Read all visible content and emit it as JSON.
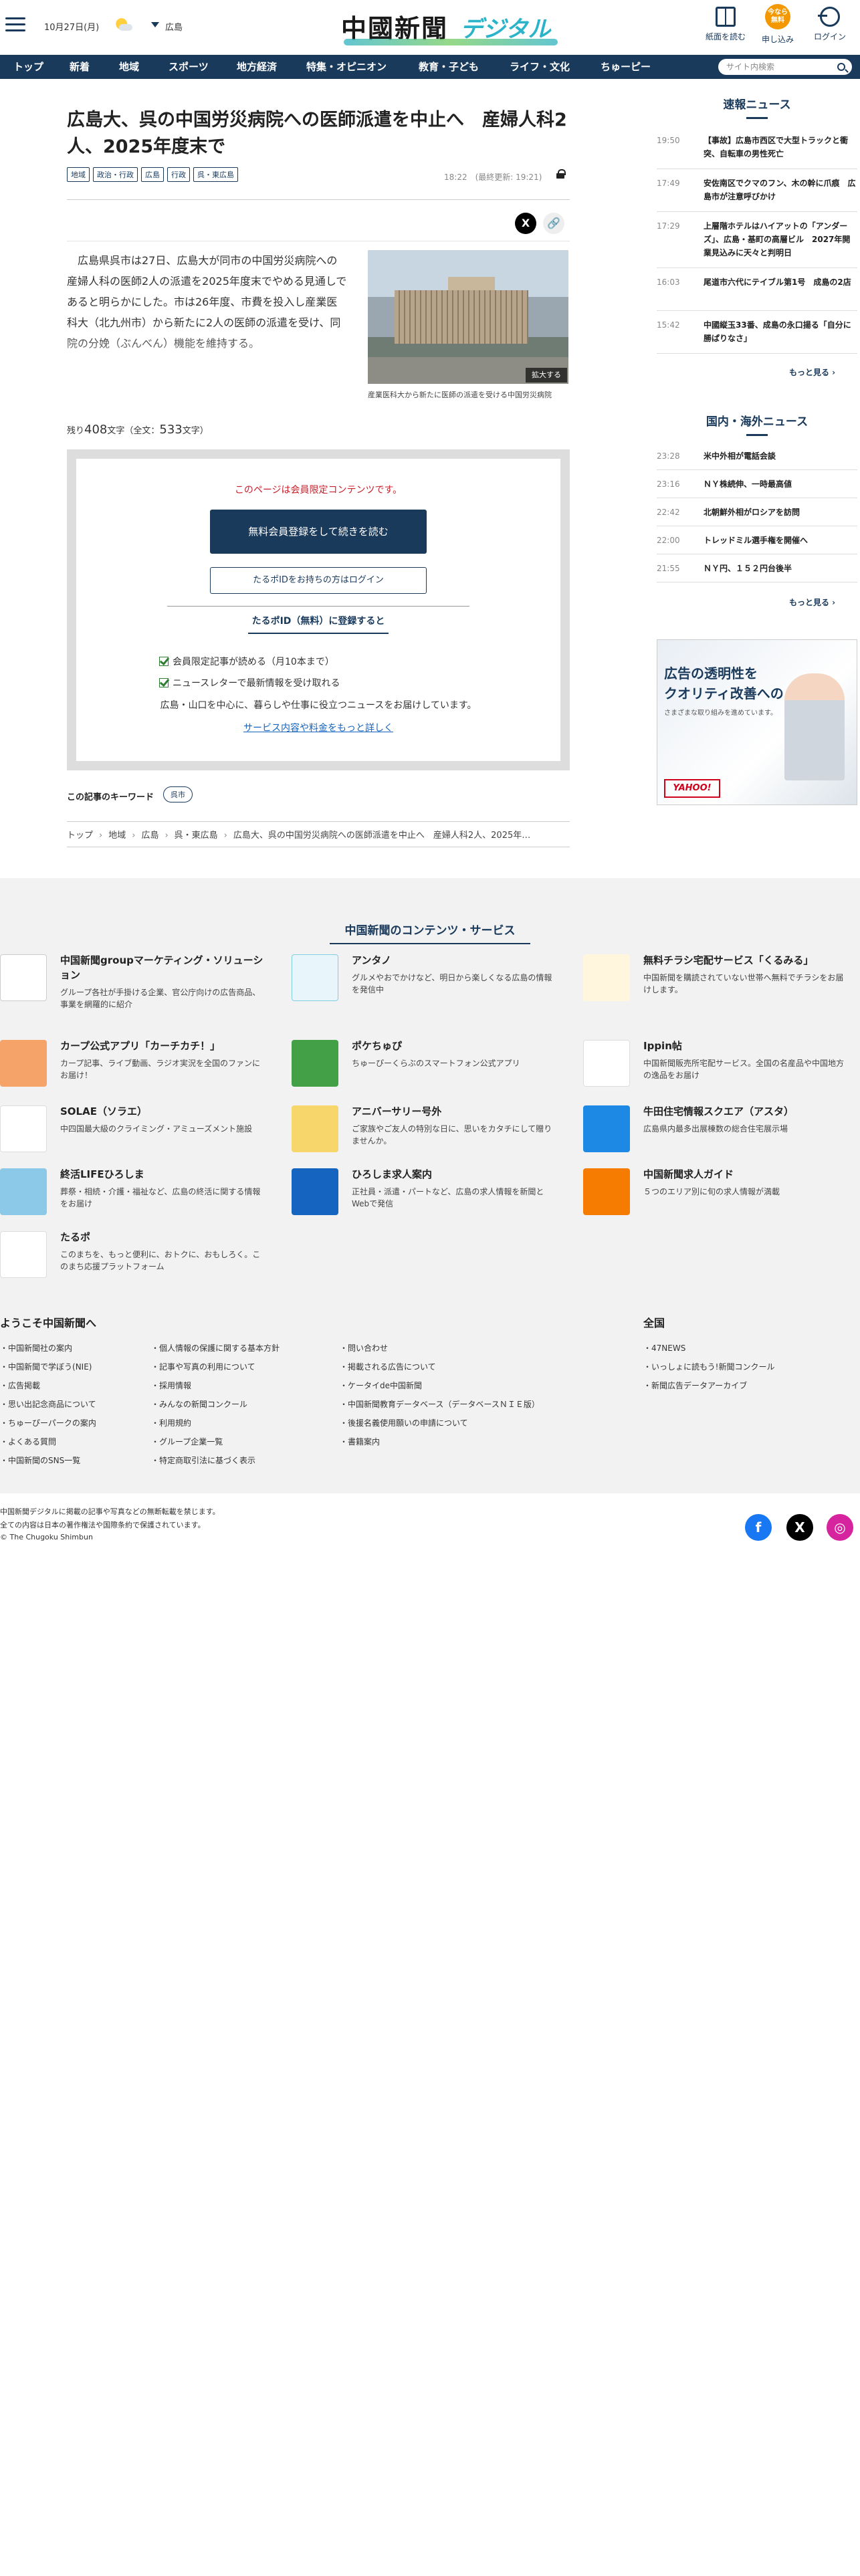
{
  "header": {
    "date": "10月27日(月)",
    "weather_icon": "sun-cloud-icon",
    "region": "広島",
    "logo_main": "中國新聞",
    "logo_sub": "デジタル",
    "buttons": [
      {
        "label": "紙面を読む",
        "icon": "newspaper-icon"
      },
      {
        "label": "申し込み",
        "icon_text": "今なら 無料",
        "icon": "apply-badge-icon"
      },
      {
        "label": "ログイン",
        "icon": "login-icon"
      }
    ]
  },
  "nav": {
    "items": [
      "トップ",
      "新着",
      "地域",
      "スポーツ",
      "地方経済",
      "特集・オピニオン",
      "教育・子ども",
      "ライフ・文化",
      "ちゅーピー"
    ],
    "search_placeholder": "サイト内検索"
  },
  "article": {
    "title": "広島大、呉の中国労災病院への医師派遣を中止へ　産婦人科2人、2025年度末で",
    "tags": [
      "地域",
      "政治・行政",
      "広島",
      "行政",
      "呉・東広島"
    ],
    "timestamp": "18:22　(最終更新: 19:21)",
    "lead": "広島県呉市は27日、広島大が同市の中国労災病院への産婦人科の医師2人の派遣を2025年度末でやめる見通しであると明らかにした。市は26年度、市費を投入し産業医科大（北九州市）から新たに2人の医師の派遣を受け、同院の分娩（ぶんべん）機能を維持する。",
    "photo_enlarge": "拡大する",
    "photo_caption": "産業医科大から新たに医師の派遣を受ける中国労災病院",
    "remaining_prefix": "残り",
    "remaining_count": "408",
    "remaining_mid": "文字（全文：",
    "total_count": "533",
    "remaining_suffix": "文字）"
  },
  "paywall": {
    "message": "このページは会員限定コンテンツです。",
    "register_label": "無料会員登録をして続きを読む",
    "login_label": "たるポIDをお持ちの方はログイン",
    "subtitle": "たるポID（無料）に登録すると",
    "benefits": [
      "会員限定記事が読める（月10本まで）",
      "ニュースレターで最新情報を受け取れる"
    ],
    "description": "広島・山口を中心に、暮らしや仕事に役立つニュースをお届けしています。",
    "details_link": "サービス内容や料金をもっと詳しく"
  },
  "keywords": {
    "label": "この記事のキーワード",
    "items": [
      "呉市"
    ]
  },
  "breadcrumb": [
    "トップ",
    "地域",
    "広島",
    "呉・東広島",
    "広島大、呉の中国労災病院への医師派遣を中止へ　産婦人科2人、2025年…"
  ],
  "sidebar": {
    "breaking": {
      "title": "速報ニュース",
      "items": [
        {
          "time": "19:50",
          "headline": "【事故】広島市西区で大型トラックと衝突、自転車の男性死亡"
        },
        {
          "time": "17:49",
          "headline": "安佐南区でクマのフン、木の幹に爪痕　広島市が注意呼びかけ"
        },
        {
          "time": "17:29",
          "headline": "上層階ホテルはハイアットの「アンダーズ」、広島・基町の高層ビル　2027年開業見込みに天々と判明日"
        },
        {
          "time": "16:03",
          "headline": "尾道市六代にテイブル第1号　成島の2店"
        },
        {
          "time": "15:42",
          "headline": "中國縦玉33番、成島の永口揚る「自分に勝ぱりなさ」"
        }
      ],
      "more": "もっと見る ›"
    },
    "world": {
      "title": "国内・海外ニュース",
      "items": [
        {
          "time": "23:28",
          "headline": "米中外相が電話会談"
        },
        {
          "time": "23:16",
          "headline": "ＮＹ株続伸、一時最高値"
        },
        {
          "time": "22:42",
          "headline": "北朝鮮外相がロシアを訪問"
        },
        {
          "time": "22:00",
          "headline": "トレッドミル選手権を開催へ"
        },
        {
          "time": "21:55",
          "headline": "ＮＹ円、１５２円台後半"
        }
      ],
      "more": "もっと見る ›"
    },
    "ad": {
      "line1": "広告の透明性を",
      "line2": "クオリティ改善への",
      "line3": "さまざまな取り組みを進めています。",
      "brand": "YAHOO!"
    }
  },
  "services": {
    "title": "中国新聞のコンテンツ・サービス",
    "items": [
      {
        "name": "中国新聞groupマーケティング・ソリューション",
        "desc": "グループ各社が手掛ける企業、官公庁向けの広告商品、事業を網羅的に紹介",
        "color": "#ffffff"
      },
      {
        "name": "アンタノ",
        "desc": "グルメやおでかけなど、明日から楽しくなる広島の情報を発信中",
        "color": "#e8f6fb"
      },
      {
        "name": "無料チラシ宅配サービス「くるみる」",
        "desc": "中国新聞を購読されていない世帯へ無料でチラシをお届けします。",
        "color": "#fff6dd"
      },
      {
        "name": "カープ公式アプリ「カーチカチ！」",
        "desc": "カープ記事、ライブ動画、ラジオ実況を全国のファンにお届け！",
        "color": "#f6a36a"
      },
      {
        "name": "ポケちゅぴ",
        "desc": "ちゅーぴーくらぶのスマートフォン公式アプリ",
        "color": "#43a047"
      },
      {
        "name": "Ippin帖",
        "desc": "中国新聞販売所宅配サービス。全国の名産品や中国地方の逸品をお届け",
        "color": "#ffffff"
      },
      {
        "name": "SOLAE（ソラエ）",
        "desc": "中四国最大級のクライミング・アミューズメント施設",
        "color": "#ffffff"
      },
      {
        "name": "アニバーサリー号外",
        "desc": "ご家族やご友人の特別な日に、思いをカタチにして贈りませんか。",
        "color": "#f7d66b"
      },
      {
        "name": "牛田住宅情報スクエア（アスタ）",
        "desc": "広島県内最多出展棟数の総合住宅展示場",
        "color": "#1e88e5"
      },
      {
        "name": "終活LIFEひろしま",
        "desc": "葬祭・相続・介護・福祉など、広島の終活に関する情報をお届け",
        "color": "#8cc9e8"
      },
      {
        "name": "ひろしま求人案内",
        "desc": "正社員・派遣・パートなど、広島の求人情報を新聞とWebで発信",
        "color": "#1565c0"
      },
      {
        "name": "中国新聞求人ガイド",
        "desc": "５つのエリア別に旬の求人情報が満載",
        "color": "#f57c00"
      },
      {
        "name": "たるポ",
        "desc": "このまちを、もっと便利に、おトクに、おもしろく。このまち応援プラットフォーム",
        "color": "#ffffff"
      }
    ]
  },
  "footer": {
    "welcome_title": "ようこそ中国新聞へ",
    "national_title": "全国",
    "col1": [
      "中国新聞社の案内",
      "中国新聞で学ぼう(NIE)",
      "広告掲載",
      "思い出記念商品について",
      "ちゅーぴーパークの案内",
      "よくある質問",
      "中国新聞のSNS一覧"
    ],
    "col2": [
      "個人情報の保護に関する基本方針",
      "記事や写真の利用について",
      "採用情報",
      "みんなの新聞コンクール",
      "利用規約",
      "グループ企業一覧",
      "特定商取引法に基づく表示"
    ],
    "col3": [
      "問い合わせ",
      "掲載される広告について",
      "ケータイde中国新聞",
      "中国新聞教育データベース（データベースＮＩＥ版）",
      "後援名義使用願いの申請について",
      "書籍案内"
    ],
    "col4": [
      "47NEWS",
      "いっしょに読もう!新聞コンクール",
      "新聞広告データアーカイブ"
    ],
    "copyright1": "中国新聞デジタルに掲載の記事や写真などの無断転載を禁じます。",
    "copyright2": "全ての内容は日本の著作権法や国際条約で保護されています。",
    "copyright3": "© The Chugoku Shimbun",
    "social": [
      {
        "name": "facebook-icon",
        "glyph": "f",
        "color": "#1877f2"
      },
      {
        "name": "x-icon",
        "glyph": "X",
        "color": "#000000"
      },
      {
        "name": "instagram-icon",
        "glyph": "◎",
        "color": "#d6249f"
      }
    ]
  }
}
